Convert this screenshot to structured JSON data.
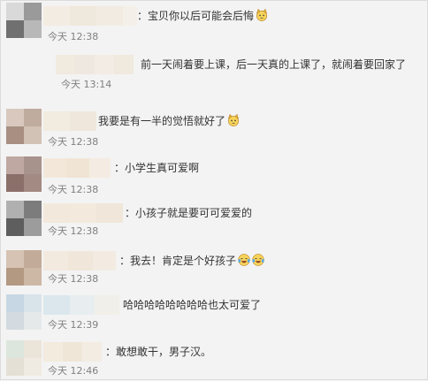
{
  "comments": [
    {
      "text": "：宝贝你以后可能会后悔",
      "emoji": "cat-face",
      "time": "今天 12:38"
    },
    {
      "text": "前一天闹着要上课，后一天真的上课了，就闹着要回家了",
      "emoji": "",
      "time": "今天 13:14"
    },
    {
      "text": "我要是有一半的觉悟就好了",
      "emoji": "cat-face",
      "time": "今天 12:38"
    },
    {
      "text": "：小学生真可爱啊",
      "emoji": "",
      "time": "今天 12:38"
    },
    {
      "text": "：小孩子就是要可可爱爱的",
      "emoji": "",
      "time": "今天 12:38"
    },
    {
      "text": "：我去！肯定是个好孩子",
      "emoji": "laughing-tears-x2",
      "time": "今天 12:38"
    },
    {
      "text": "哈哈哈哈哈哈哈哈也太可爱了",
      "emoji": "",
      "time": "今天 12:39"
    },
    {
      "text": "：敢想敢干，男子汉。",
      "emoji": "",
      "time": "今天 12:46"
    }
  ]
}
